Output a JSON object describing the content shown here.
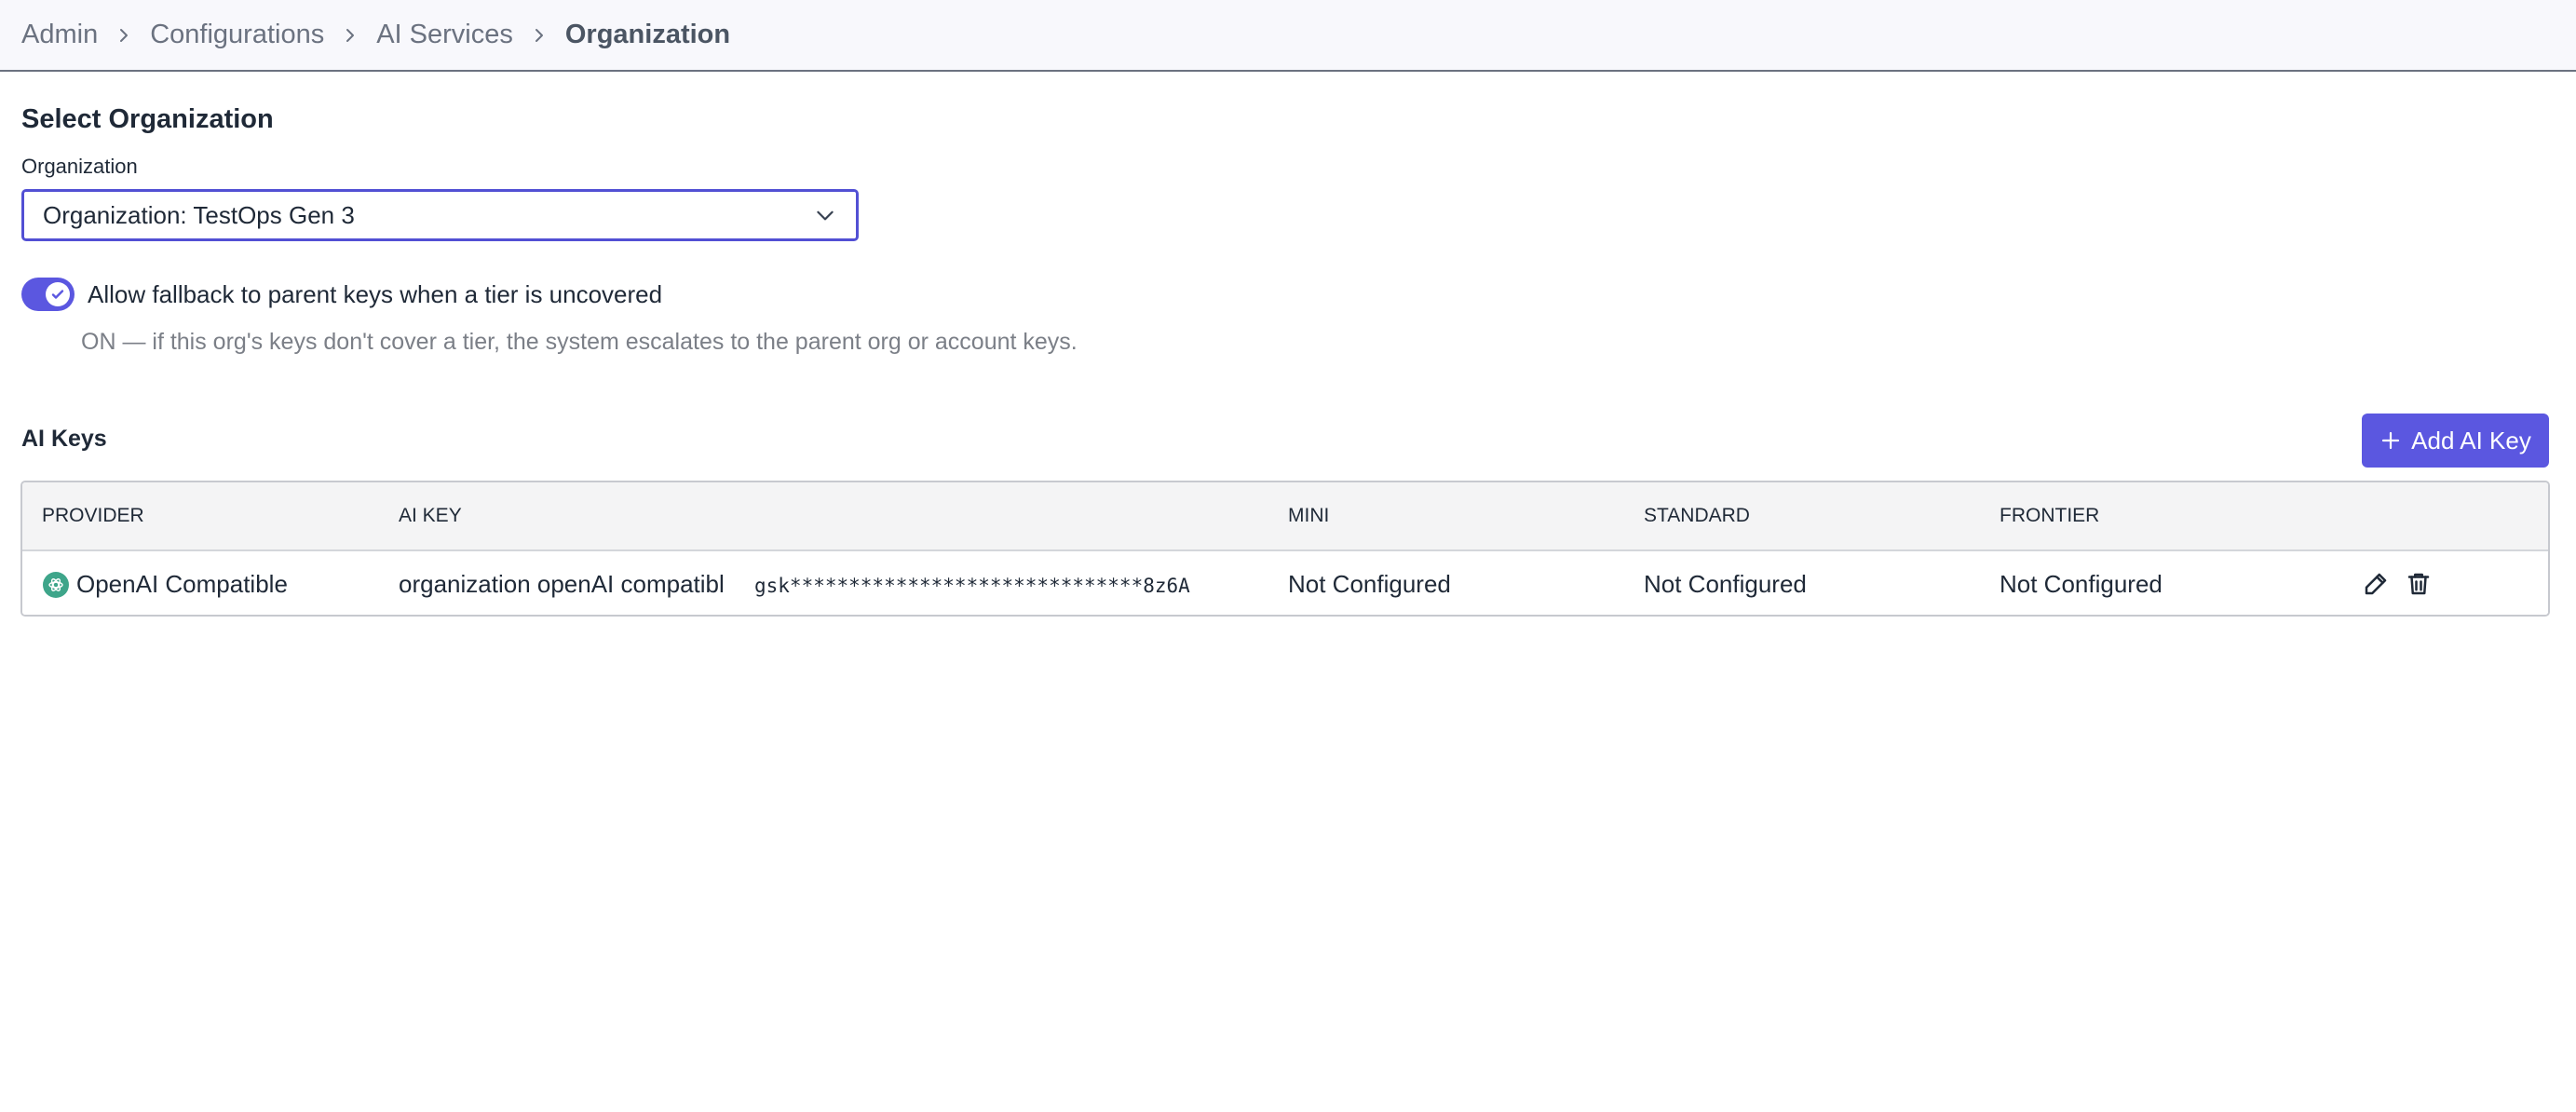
{
  "breadcrumb": {
    "items": [
      {
        "label": "Admin"
      },
      {
        "label": "Configurations"
      },
      {
        "label": "AI Services"
      }
    ],
    "current": "Organization"
  },
  "select_org": {
    "title": "Select Organization",
    "field_label": "Organization",
    "selected_value": "Organization: TestOps Gen 3"
  },
  "fallback": {
    "enabled": true,
    "label": "Allow fallback to parent keys when a tier is uncovered",
    "help_text": "ON — if this org's keys don't cover a tier, the system escalates to the parent org or account keys."
  },
  "ai_keys": {
    "title": "AI Keys",
    "add_button_label": "Add AI Key",
    "columns": [
      "PROVIDER",
      "AI KEY",
      "MINI",
      "STANDARD",
      "FRONTIER"
    ],
    "rows": [
      {
        "provider": "OpenAI Compatible",
        "provider_icon": "openai-icon",
        "key_name": "organization openAI compatibl",
        "key_masked": "gsk******************************8z6A",
        "mini": "Not Configured",
        "standard": "Not Configured",
        "frontier": "Not Configured"
      }
    ]
  },
  "colors": {
    "accent": "#5b57e0",
    "provider_icon_bg": "#3ea58a"
  }
}
